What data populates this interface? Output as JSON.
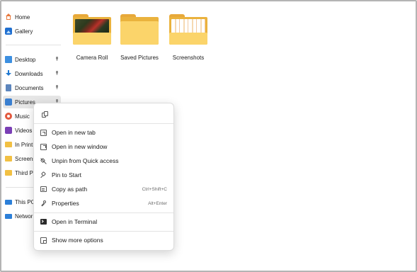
{
  "sidebar": {
    "items": [
      {
        "label": "Home",
        "icon": "home-icon"
      },
      {
        "label": "Gallery",
        "icon": "gallery-icon"
      },
      {
        "label": "Desktop",
        "icon": "desktop-icon",
        "pinned": true
      },
      {
        "label": "Downloads",
        "icon": "downloads-icon",
        "pinned": true
      },
      {
        "label": "Documents",
        "icon": "documents-icon",
        "pinned": true
      },
      {
        "label": "Pictures",
        "icon": "pictures-icon",
        "pinned": true,
        "selected": true
      },
      {
        "label": "Music",
        "icon": "music-icon"
      },
      {
        "label": "Videos",
        "icon": "videos-icon"
      },
      {
        "label": "In Print",
        "icon": "folder-icon"
      },
      {
        "label": "Screens",
        "icon": "folder-icon"
      },
      {
        "label": "Third P",
        "icon": "folder-icon"
      },
      {
        "label": "This PC",
        "icon": "this-pc-icon"
      },
      {
        "label": "Networ",
        "icon": "network-icon"
      }
    ]
  },
  "folders": [
    {
      "name": "Camera Roll"
    },
    {
      "name": "Saved Pictures"
    },
    {
      "name": "Screenshots"
    }
  ],
  "context_menu": {
    "top_icon": "copy-icon",
    "items": [
      {
        "label": "Open in new tab",
        "icon": "open-new-tab-icon",
        "shortcut": ""
      },
      {
        "label": "Open in new window",
        "icon": "open-new-window-icon",
        "shortcut": ""
      },
      {
        "label": "Unpin from Quick access",
        "icon": "unpin-icon",
        "shortcut": ""
      },
      {
        "label": "Pin to Start",
        "icon": "pin-icon",
        "shortcut": ""
      },
      {
        "label": "Copy as path",
        "icon": "copy-path-icon",
        "shortcut": "Ctrl+Shift+C"
      },
      {
        "label": "Properties",
        "icon": "properties-icon",
        "shortcut": "Alt+Enter"
      },
      {
        "label": "Open in Terminal",
        "icon": "terminal-icon",
        "shortcut": ""
      },
      {
        "label": "Show more options",
        "icon": "show-more-options-icon",
        "shortcut": ""
      }
    ]
  },
  "colors": {
    "folder": "#fbd46a",
    "folder_back": "#eab23d",
    "selected_bg": "#e6e6e6",
    "frame_border": "#b4b4b4"
  }
}
